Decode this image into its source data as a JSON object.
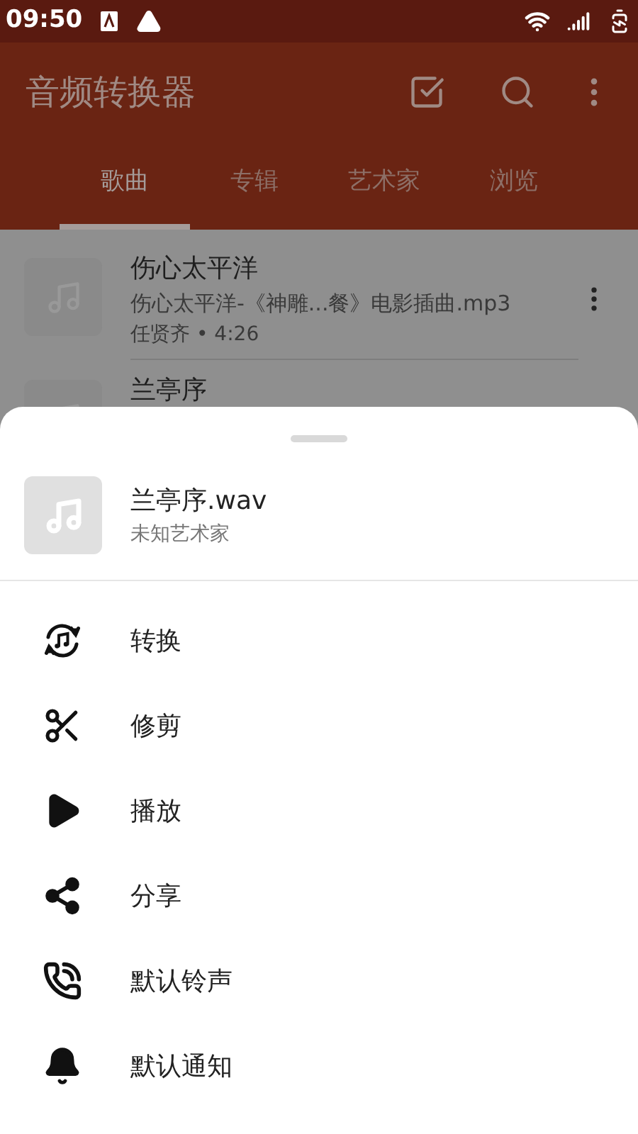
{
  "status_bar": {
    "time": "09:50"
  },
  "app_bar": {
    "title": "音频转换器"
  },
  "tabs": [
    {
      "label": "歌曲",
      "selected": true
    },
    {
      "label": "专辑",
      "selected": false
    },
    {
      "label": "艺术家",
      "selected": false
    },
    {
      "label": "浏览",
      "selected": false
    }
  ],
  "songs": [
    {
      "title": "伤心太平洋",
      "file": "伤心太平洋-《神雕...餐》电影插曲.mp3",
      "meta": "任贤齐 • 4:26"
    },
    {
      "title": "兰亭序"
    }
  ],
  "sheet": {
    "title": "兰亭序.wav",
    "subtitle": "未知艺术家",
    "actions": [
      {
        "kind": "convert",
        "label": "转换"
      },
      {
        "kind": "trim",
        "label": "修剪"
      },
      {
        "kind": "play",
        "label": "播放"
      },
      {
        "kind": "share",
        "label": "分享"
      },
      {
        "kind": "ringtone",
        "label": "默认铃声"
      },
      {
        "kind": "notification",
        "label": "默认通知"
      }
    ]
  }
}
